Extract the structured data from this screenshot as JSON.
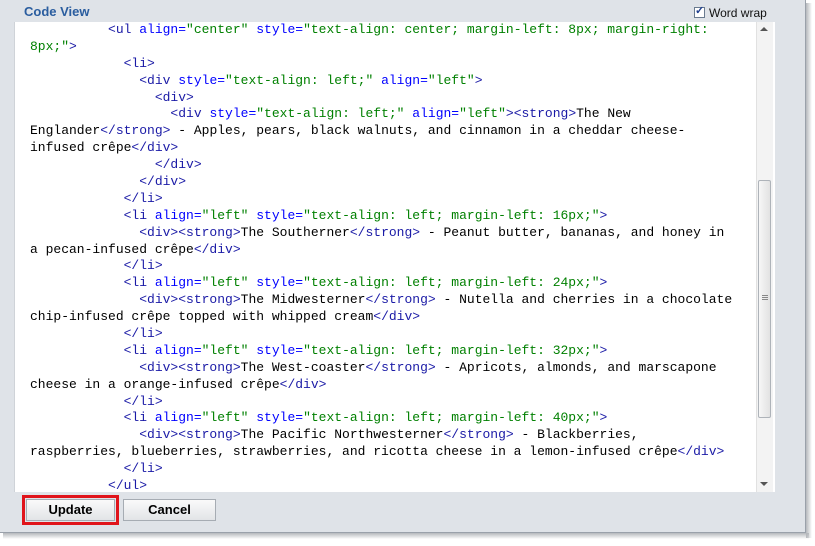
{
  "panel": {
    "title": "Code View",
    "word_wrap": {
      "label": "Word wrap",
      "checked": true,
      "check_glyph": "✓"
    }
  },
  "editor": {
    "lines": [
      [
        {
          "t": "tg",
          "v": "          <ul"
        },
        {
          "t": "at",
          "v": " align="
        },
        {
          "t": "st",
          "v": "\"center\""
        },
        {
          "t": "at",
          "v": " style="
        },
        {
          "t": "st",
          "v": "\"text-align: center; margin-left: 8px; margin-right:"
        }
      ],
      [
        {
          "t": "st",
          "v": "8px;\""
        },
        {
          "t": "tg",
          "v": ">"
        }
      ],
      [
        {
          "t": "tg",
          "v": "            <li>"
        }
      ],
      [
        {
          "t": "tg",
          "v": "              <div"
        },
        {
          "t": "at",
          "v": " style="
        },
        {
          "t": "st",
          "v": "\"text-align: left;\""
        },
        {
          "t": "at",
          "v": " align="
        },
        {
          "t": "st",
          "v": "\"left\""
        },
        {
          "t": "tg",
          "v": ">"
        }
      ],
      [
        {
          "t": "tg",
          "v": "                <div>"
        }
      ],
      [
        {
          "t": "tg",
          "v": "                  <div"
        },
        {
          "t": "at",
          "v": " style="
        },
        {
          "t": "st",
          "v": "\"text-align: left;\""
        },
        {
          "t": "at",
          "v": " align="
        },
        {
          "t": "st",
          "v": "\"left\""
        },
        {
          "t": "tg",
          "v": "><strong>"
        },
        {
          "t": "tx",
          "v": "The New"
        }
      ],
      [
        {
          "t": "tx",
          "v": "Englander"
        },
        {
          "t": "tg",
          "v": "</strong>"
        },
        {
          "t": "tx",
          "v": " - Apples, pears, black walnuts, and cinnamon in a cheddar cheese-"
        }
      ],
      [
        {
          "t": "tx",
          "v": "infused crêpe"
        },
        {
          "t": "tg",
          "v": "</div>"
        }
      ],
      [
        {
          "t": "tg",
          "v": "                </div>"
        }
      ],
      [
        {
          "t": "tg",
          "v": "              </div>"
        }
      ],
      [
        {
          "t": "tg",
          "v": "            </li>"
        }
      ],
      [
        {
          "t": "tg",
          "v": "            <li"
        },
        {
          "t": "at",
          "v": " align="
        },
        {
          "t": "st",
          "v": "\"left\""
        },
        {
          "t": "at",
          "v": " style="
        },
        {
          "t": "st",
          "v": "\"text-align: left; margin-left: 16px;\""
        },
        {
          "t": "tg",
          "v": ">"
        }
      ],
      [
        {
          "t": "tg",
          "v": "              <div><strong>"
        },
        {
          "t": "tx",
          "v": "The Southerner"
        },
        {
          "t": "tg",
          "v": "</strong>"
        },
        {
          "t": "tx",
          "v": " - Peanut butter, bananas, and honey in"
        }
      ],
      [
        {
          "t": "tx",
          "v": "a pecan-infused crêpe"
        },
        {
          "t": "tg",
          "v": "</div>"
        }
      ],
      [
        {
          "t": "tg",
          "v": "            </li>"
        }
      ],
      [
        {
          "t": "tg",
          "v": "            <li"
        },
        {
          "t": "at",
          "v": " align="
        },
        {
          "t": "st",
          "v": "\"left\""
        },
        {
          "t": "at",
          "v": " style="
        },
        {
          "t": "st",
          "v": "\"text-align: left; margin-left: 24px;\""
        },
        {
          "t": "tg",
          "v": ">"
        }
      ],
      [
        {
          "t": "tg",
          "v": "              <div><strong>"
        },
        {
          "t": "tx",
          "v": "The Midwesterner"
        },
        {
          "t": "tg",
          "v": "</strong>"
        },
        {
          "t": "tx",
          "v": " - Nutella and cherries in a chocolate"
        }
      ],
      [
        {
          "t": "tx",
          "v": "chip-infused crêpe topped with whipped cream"
        },
        {
          "t": "tg",
          "v": "</div>"
        }
      ],
      [
        {
          "t": "tg",
          "v": "            </li>"
        }
      ],
      [
        {
          "t": "tg",
          "v": "            <li"
        },
        {
          "t": "at",
          "v": " align="
        },
        {
          "t": "st",
          "v": "\"left\""
        },
        {
          "t": "at",
          "v": " style="
        },
        {
          "t": "st",
          "v": "\"text-align: left; margin-left: 32px;\""
        },
        {
          "t": "tg",
          "v": ">"
        }
      ],
      [
        {
          "t": "tg",
          "v": "              <div><strong>"
        },
        {
          "t": "tx",
          "v": "The West-coaster"
        },
        {
          "t": "tg",
          "v": "</strong>"
        },
        {
          "t": "tx",
          "v": " - Apricots, almonds, and marscapone"
        }
      ],
      [
        {
          "t": "tx",
          "v": "cheese in a orange-infused crêpe"
        },
        {
          "t": "tg",
          "v": "</div>"
        }
      ],
      [
        {
          "t": "tg",
          "v": "            </li>"
        }
      ],
      [
        {
          "t": "tg",
          "v": "            <li"
        },
        {
          "t": "at",
          "v": " align="
        },
        {
          "t": "st",
          "v": "\"left\""
        },
        {
          "t": "at",
          "v": " style="
        },
        {
          "t": "st",
          "v": "\"text-align: left; margin-left: 40px;\""
        },
        {
          "t": "tg",
          "v": ">"
        }
      ],
      [
        {
          "t": "tg",
          "v": "              <div><strong>"
        },
        {
          "t": "tx",
          "v": "The Pacific Northwesterner"
        },
        {
          "t": "tg",
          "v": "</strong>"
        },
        {
          "t": "tx",
          "v": " - Blackberries,"
        }
      ],
      [
        {
          "t": "tx",
          "v": "raspberries, blueberries, strawberries, and ricotta cheese in a lemon-infused crêpe"
        },
        {
          "t": "tg",
          "v": "</div>"
        }
      ],
      [
        {
          "t": "tg",
          "v": "            </li>"
        }
      ],
      [
        {
          "t": "tg",
          "v": "          </ul>"
        }
      ]
    ]
  },
  "buttons": {
    "update": "Update",
    "cancel": "Cancel"
  },
  "colors": {
    "tag": "#1a1aa6",
    "attribute": "#0000ff",
    "string": "#008000",
    "highlight_border": "#e0141b",
    "title": "#2a5d9f"
  }
}
